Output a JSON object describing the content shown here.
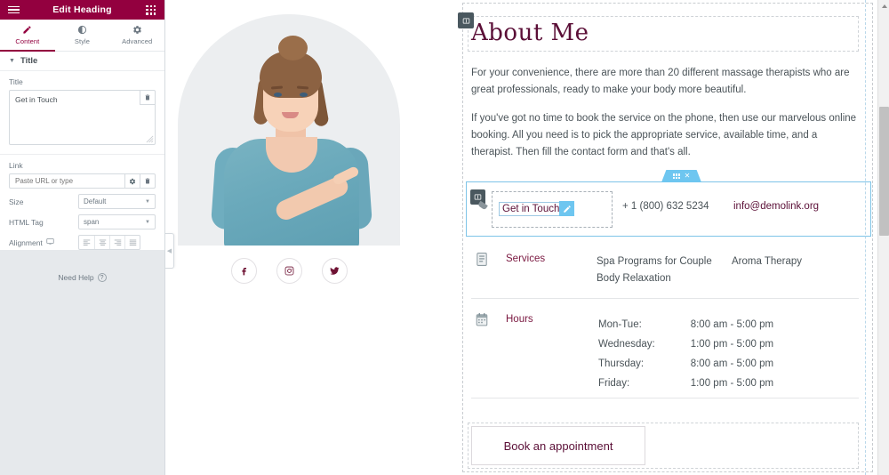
{
  "panel": {
    "header": {
      "title": "Edit Heading",
      "menu_icon": "hamburger-icon",
      "apps_icon": "grid-apps-icon"
    },
    "tabs": [
      {
        "label": "Content",
        "icon": "pencil-icon",
        "active": true
      },
      {
        "label": "Style",
        "icon": "contrast-circle-icon",
        "active": false
      },
      {
        "label": "Advanced",
        "icon": "gear-icon",
        "active": false
      }
    ],
    "section": {
      "title": "Title",
      "collapse_icon": "caret-down-icon"
    },
    "fields": {
      "title_label": "Title",
      "title_value": "Get in Touch",
      "title_delete_icon": "trash-icon",
      "link_label": "Link",
      "link_value": "",
      "link_placeholder": "Paste URL or type",
      "link_settings_icon": "gear-icon",
      "link_delete_icon": "trash-icon",
      "size_label": "Size",
      "size_value": "Default",
      "html_tag_label": "HTML Tag",
      "html_tag_value": "span",
      "alignment_label": "Alignment",
      "alignment_device_icon": "monitor-icon",
      "alignment_options": [
        "align-left-icon",
        "align-center-icon",
        "align-right-icon",
        "align-justify-icon"
      ]
    },
    "footer": {
      "need_help": "Need Help",
      "help_icon": "question-circle-icon"
    },
    "collapse_handle_icon": "chevron-left-icon"
  },
  "canvas": {
    "photo": {
      "alt": "woman-pointing-photo",
      "shape": "arch"
    },
    "socials": [
      {
        "name": "facebook-icon",
        "glyph": "f"
      },
      {
        "name": "instagram-icon",
        "glyph": "camera"
      },
      {
        "name": "twitter-icon",
        "glyph": "bird"
      }
    ],
    "heading": "About Me",
    "heading_handle_icon": "widget-handle-icon",
    "paragraphs": [
      "For your convenience, there are more than 20 different massage therapists who are great professionals, ready to make your body more beautiful.",
      "If you've got no time to book the service on the phone, then use our marvelous online booking. All you need is to pick the appropriate service, available time, and a therapist. Then fill the contact form and that's all."
    ],
    "contact_section": {
      "tab_drag_icon": "drag-dots-icon",
      "tab_close_icon": "close-x-icon",
      "widget_handle_icon": "widget-handle-icon",
      "get_in_touch": "Get in Touch",
      "edit_badge_icon": "pencil-icon",
      "phone": "+ 1 (800) 632 5234",
      "email": "info@demolink.org"
    },
    "rows": [
      {
        "icon": "document-list-icon",
        "title": "Services",
        "col_a": [
          "Spa Programs for Couple",
          "Body Relaxation"
        ],
        "col_b": [
          "Aroma Therapy"
        ]
      }
    ],
    "hours": {
      "icon": "calendar-icon",
      "title": "Hours",
      "entries": [
        {
          "day": "Mon-Tue:",
          "time": "8:00 am - 5:00 pm"
        },
        {
          "day": "Wednesday:",
          "time": "1:00 pm - 5:00 pm"
        },
        {
          "day": "Thursday:",
          "time": "8:00 am - 5:00 pm"
        },
        {
          "day": "Friday:",
          "time": "1:00 pm - 5:00 pm"
        }
      ]
    },
    "book_button": "Book an appointment"
  },
  "scrollbar": {
    "up_icon": "scroll-up-arrow-icon"
  },
  "colors": {
    "brand": "#93003f",
    "accent_blue": "#6ec6f0",
    "heading": "#5b0f37",
    "body_text": "#4a5358"
  }
}
